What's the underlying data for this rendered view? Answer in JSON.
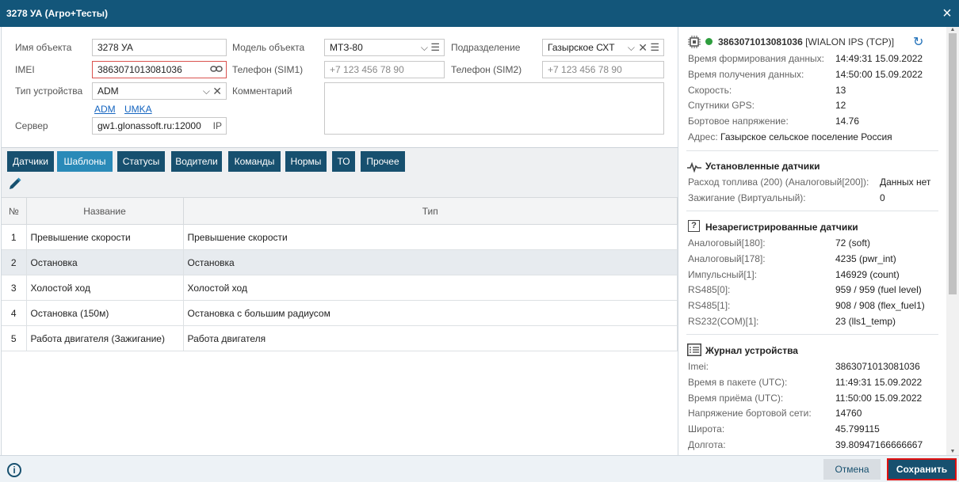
{
  "window": {
    "title": "3278 УА (Агро+Тесты)",
    "close_icon": "×"
  },
  "form": {
    "name_label": "Имя объекта",
    "name_value": "3278 УА",
    "imei_label": "IMEI",
    "imei_value": "3863071013081036",
    "device_type_label": "Тип устройства",
    "device_type_value": "ADM",
    "device_links": [
      "ADM",
      "UMKA"
    ],
    "server_label": "Сервер",
    "server_value": "gw1.glonassoft.ru:12000",
    "server_suffix": "IP",
    "model_label": "Модель объекта",
    "model_value": "МТЗ-80",
    "sim1_label": "Телефон (SIM1)",
    "sim1_placeholder": "+7 123 456 78 90",
    "comment_label": "Комментарий",
    "division_label": "Подразделение",
    "division_value": "Газырское СХТ",
    "sim2_label": "Телефон (SIM2)",
    "sim2_placeholder": "+7 123 456 78 90"
  },
  "tabs": [
    "Датчики",
    "Шаблоны",
    "Статусы",
    "Водители",
    "Команды",
    "Нормы",
    "ТО",
    "Прочее"
  ],
  "active_tab": "Шаблоны",
  "table": {
    "headers": [
      "№",
      "Название",
      "Тип"
    ],
    "rows": [
      [
        "1",
        "Превышение скорости",
        "Превышение скорости"
      ],
      [
        "2",
        "Остановка",
        "Остановка"
      ],
      [
        "3",
        "Холостой ход",
        "Холостой ход"
      ],
      [
        "4",
        "Остановка (150м)",
        "Остановка с большим радиусом"
      ],
      [
        "5",
        "Работа двигателя (Зажигание)",
        "Работа двигателя"
      ]
    ]
  },
  "device": {
    "id": "3863071013081036",
    "protocol": "[WIALON IPS (TCP)]",
    "status_color": "#2e9e3e",
    "info": [
      {
        "k": "Время формирования данных:",
        "v": "14:49:31 15.09.2022"
      },
      {
        "k": "Время получения данных:",
        "v": "14:50:00 15.09.2022"
      },
      {
        "k": "Скорость:",
        "v": "13"
      },
      {
        "k": "Спутники GPS:",
        "v": "12"
      },
      {
        "k": "Бортовое напряжение:",
        "v": "14.76"
      }
    ],
    "address_label": "Адрес:",
    "address_value": "Газырское сельское поселение Россия"
  },
  "installed_sensors": {
    "title": "Установленные датчики",
    "items": [
      {
        "k": "Расход топлива (200) (Аналоговый[200]):",
        "v": "Данных нет"
      },
      {
        "k": "Зажигание (Виртуальный):",
        "v": "0"
      }
    ]
  },
  "unregistered_sensors": {
    "title": "Незарегистрированные датчики",
    "items": [
      {
        "k": "Аналоговый[180]:",
        "v": "72 (soft)"
      },
      {
        "k": "Аналоговый[178]:",
        "v": "4235 (pwr_int)"
      },
      {
        "k": "Импульсный[1]:",
        "v": "146929 (count)"
      },
      {
        "k": "RS485[0]:",
        "v": "959 / 959 (fuel level)"
      },
      {
        "k": "RS485[1]:",
        "v": "908 / 908 (flex_fuel1)"
      },
      {
        "k": "RS232(COM)[1]:",
        "v": "23 (lls1_temp)"
      }
    ]
  },
  "device_log": {
    "title": "Журнал устройства",
    "items": [
      {
        "k": "Imei:",
        "v": "3863071013081036"
      },
      {
        "k": "Время в пакете (UTC):",
        "v": "11:49:31 15.09.2022"
      },
      {
        "k": "Время приёма (UTC):",
        "v": "11:50:00 15.09.2022"
      },
      {
        "k": "Напряжение бортовой сети:",
        "v": "14760"
      },
      {
        "k": "Широта:",
        "v": "45.799115"
      },
      {
        "k": "Долгота:",
        "v": "39.80947166666667"
      }
    ]
  },
  "footer": {
    "info_icon": "i",
    "cancel_label": "Отмена",
    "save_label": "Сохранить"
  }
}
